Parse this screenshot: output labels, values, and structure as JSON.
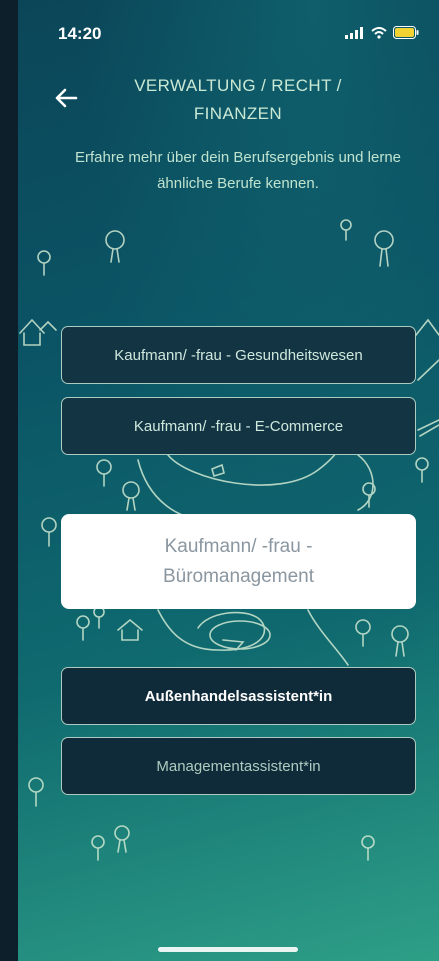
{
  "status": {
    "time": "14:20"
  },
  "header": {
    "title": "VERWALTUNG / RECHT / FINANZEN",
    "subtitle": "Erfahre mehr über dein Berufsergebnis und lerne ähnliche Berufe kennen."
  },
  "options": [
    {
      "label": "Kaufmann/ -frau - Gesundheitswesen"
    },
    {
      "label": "Kaufmann/ -frau - E-Commerce"
    },
    {
      "label": "Kaufmann/ -frau - Büromanagement"
    },
    {
      "label": "Außenhandelsassistent*in"
    },
    {
      "label": "Managementassistent*in"
    }
  ],
  "icons": {
    "back": "arrow-left-icon"
  }
}
